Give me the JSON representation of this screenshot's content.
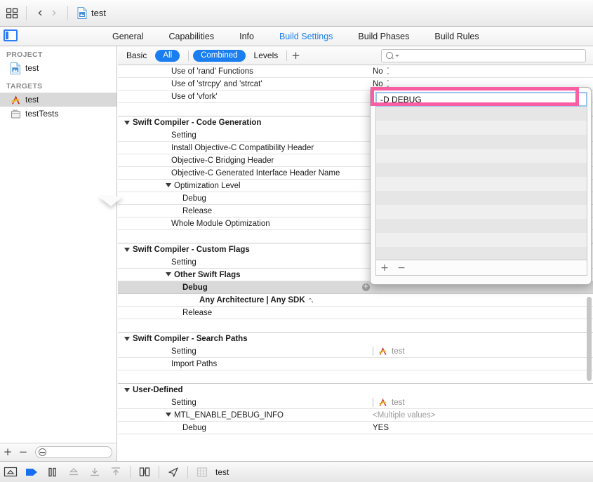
{
  "toolbar": {
    "grid_icon": "grid-icon",
    "back_icon": "‹",
    "forward_icon": "›",
    "document_icon": "xcode-project-document-icon",
    "title": "test"
  },
  "tabbar": {
    "panel_toggle_icon": "navigator-toggle-icon",
    "tabs": [
      {
        "label": "General",
        "active": false
      },
      {
        "label": "Capabilities",
        "active": false
      },
      {
        "label": "Info",
        "active": false
      },
      {
        "label": "Build Settings",
        "active": true
      },
      {
        "label": "Build Phases",
        "active": false
      },
      {
        "label": "Build Rules",
        "active": false
      }
    ]
  },
  "sidebar": {
    "project_header": "PROJECT",
    "targets_header": "TARGETS",
    "project_items": [
      {
        "label": "test",
        "icon": "project-file-icon",
        "selected": false
      }
    ],
    "target_items": [
      {
        "label": "test",
        "icon": "app-target-icon",
        "selected": true
      },
      {
        "label": "testTests",
        "icon": "test-bundle-icon",
        "selected": false
      }
    ],
    "footer": {
      "add_label": "+",
      "remove_label": "−",
      "filter_placeholder": ""
    }
  },
  "build_settings_toolbar": {
    "segments": [
      {
        "label": "Basic",
        "active": false
      },
      {
        "label": "All",
        "active": true
      },
      {
        "label": "Combined",
        "active": true
      },
      {
        "label": "Levels",
        "active": false
      }
    ],
    "add_label": "+",
    "search_placeholder": ""
  },
  "settings_rows": [
    {
      "type": "row",
      "indent": "i1",
      "name": "Use of 'rand' Functions",
      "value": "No",
      "stepper": true
    },
    {
      "type": "row",
      "indent": "i1",
      "name": "Use of 'strcpy' and 'strcat'",
      "value": "No",
      "stepper": true
    },
    {
      "type": "row",
      "indent": "i1",
      "name": "Use of 'vfork'",
      "value": "",
      "stepper": false
    },
    {
      "type": "blank"
    },
    {
      "type": "group",
      "name": "Swift Compiler - Code Generation"
    },
    {
      "type": "row",
      "indent": "i1",
      "name": "Setting",
      "muted_name": true,
      "value": "",
      "stepper": false
    },
    {
      "type": "row",
      "indent": "i1",
      "name": "Install Objective-C Compatibility Header",
      "value": "",
      "stepper": false
    },
    {
      "type": "row",
      "indent": "i1",
      "name": "Objective-C Bridging Header",
      "value": "",
      "stepper": false
    },
    {
      "type": "row",
      "indent": "i1",
      "name": "Objective-C Generated Interface Header Name",
      "value": "",
      "stepper": false
    },
    {
      "type": "row",
      "indent": "i2",
      "disclosure": true,
      "name": "Optimization Level",
      "value": "",
      "stepper": false
    },
    {
      "type": "row",
      "indent": "i3",
      "name": "Debug",
      "value": "",
      "stepper": false
    },
    {
      "type": "row",
      "indent": "i3",
      "name": "Release",
      "value": "",
      "stepper": false
    },
    {
      "type": "row",
      "indent": "i1",
      "name": "Whole Module Optimization",
      "value": "",
      "stepper": false
    },
    {
      "type": "blank"
    },
    {
      "type": "group",
      "name": "Swift Compiler - Custom Flags"
    },
    {
      "type": "row",
      "indent": "i1",
      "name": "Setting",
      "muted_name": true,
      "value": "",
      "stepper": false
    },
    {
      "type": "row",
      "indent": "i2",
      "disclosure": true,
      "bold": true,
      "name": "Other Swift Flags",
      "value": "",
      "stepper": false
    },
    {
      "type": "row",
      "indent": "i3",
      "bold": true,
      "highlight": true,
      "name": "Debug",
      "value": "",
      "plus_circle": "+"
    },
    {
      "type": "row",
      "indent": "i4",
      "bold": true,
      "name": "Any Architecture | Any SDK",
      "value": "",
      "stepper_inline": true
    },
    {
      "type": "row",
      "indent": "i3",
      "name": "Release",
      "value": "",
      "stepper": false
    },
    {
      "type": "blank"
    },
    {
      "type": "group",
      "name": "Swift Compiler - Search Paths"
    },
    {
      "type": "row",
      "indent": "i1",
      "name": "Setting",
      "muted_name": true,
      "target_value": "test",
      "target_icon": "app-target-icon"
    },
    {
      "type": "row",
      "indent": "i1",
      "name": "Import Paths",
      "value": "",
      "stepper": false
    },
    {
      "type": "blank"
    },
    {
      "type": "group",
      "name": "User-Defined"
    },
    {
      "type": "row",
      "indent": "i1",
      "name": "Setting",
      "muted_name": true,
      "target_value": "test",
      "target_icon": "app-target-icon"
    },
    {
      "type": "row",
      "indent": "i2",
      "disclosure": true,
      "name": "MTL_ENABLE_DEBUG_INFO",
      "value": "<Multiple values>",
      "muted_value": true
    },
    {
      "type": "row",
      "indent": "i3",
      "name": "Debug",
      "value": "YES"
    }
  ],
  "popover": {
    "edit_value": "-D DEBUG",
    "row_count": 11,
    "add_label": "+",
    "remove_label": "−",
    "highlight_color": "#f75fa2",
    "focus_border_color": "#9dc4f0"
  },
  "bottombar": {
    "icons": [
      "breakpoint-navigator-icon",
      "continue-icon",
      "step-over-icon",
      "step-into-icon",
      "step-out-icon",
      "step-up-icon",
      "simulate-location-icon",
      "view-hierarchy-icon",
      "memory-graph-icon"
    ],
    "label": "test"
  }
}
